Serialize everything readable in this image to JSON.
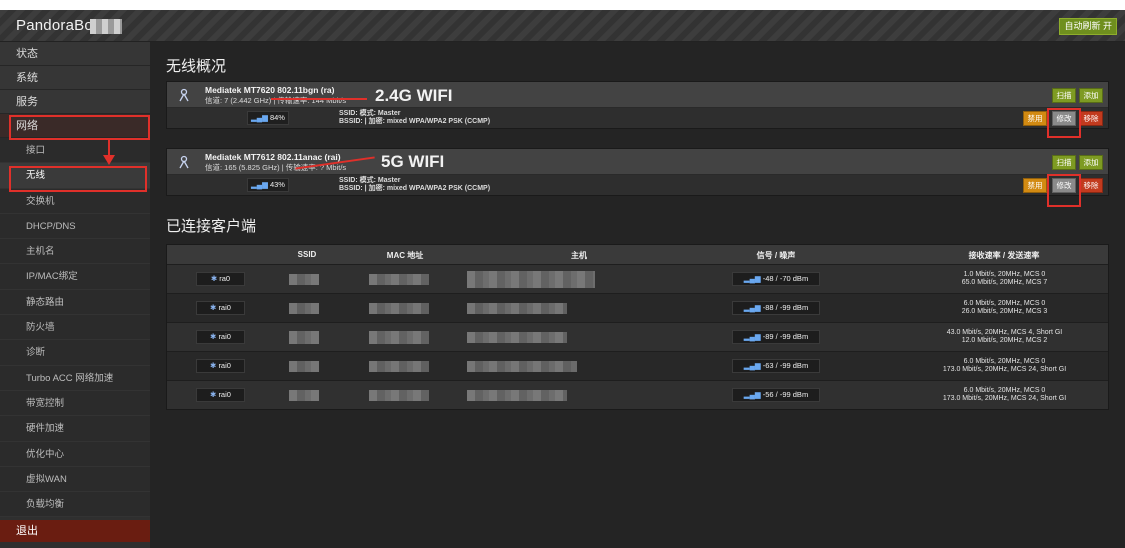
{
  "header": {
    "brand": "PandoraBox",
    "auto_refresh": "自动刷新 开"
  },
  "sidebar": {
    "top_items": [
      "状态",
      "系统",
      "服务",
      "网络"
    ],
    "sub_items": [
      "接口",
      "无线",
      "交换机",
      "DHCP/DNS",
      "主机名",
      "IP/MAC绑定",
      "静态路由",
      "防火墙",
      "诊断",
      "Turbo ACC 网络加速",
      "带宽控制",
      "硬件加速",
      "优化中心",
      "虚拟WAN",
      "负载均衡"
    ],
    "logout": "退出"
  },
  "overview": {
    "title": "无线概况",
    "radios": [
      {
        "name": "Mediatek MT7620 802.11bgn (ra)",
        "info": "信道: 7 (2.442 GHz) | 传输速率: 144 Mbit/s",
        "callout": "2.4G WIFI",
        "signal": "84%",
        "ssid_line": "SSID:          模式: Master",
        "bssid_line": "BSSID:                        | 加密: mixed WPA/WPA2 PSK (CCMP)",
        "btn_scan": "扫描",
        "btn_add": "添加",
        "btn_disable": "禁用",
        "btn_edit": "修改",
        "btn_remove": "移除"
      },
      {
        "name": "Mediatek MT7612 802.11anac (rai)",
        "info": "信道: 165 (5.825 GHz) | 传输速率: ? Mbit/s",
        "callout": "5G WIFI",
        "signal": "43%",
        "ssid_line": "SSID:          模式: Master",
        "bssid_line": "BSSID:                        | 加密: mixed WPA/WPA2 PSK (CCMP)",
        "btn_scan": "扫描",
        "btn_add": "添加",
        "btn_disable": "禁用",
        "btn_edit": "修改",
        "btn_remove": "移除"
      }
    ]
  },
  "clients": {
    "title": "已连接客户端",
    "columns": [
      "SSID",
      "MAC 地址",
      "主机",
      "信号 / 噪声",
      "接收速率 / 发送速率"
    ],
    "rows": [
      {
        "iface": "ra0",
        "signal": "-48 / -70 dBm",
        "rate1": "1.0 Mbit/s, 20MHz, MCS 0",
        "rate2": "65.0 Mbit/s, 20MHz, MCS 7"
      },
      {
        "iface": "rai0",
        "signal": "-88 / -99 dBm",
        "rate1": "6.0 Mbit/s, 20MHz, MCS 0",
        "rate2": "26.0 Mbit/s, 20MHz, MCS 3"
      },
      {
        "iface": "rai0",
        "signal": "-89 / -99 dBm",
        "rate1": "43.0 Mbit/s, 20MHz, MCS 4, Short GI",
        "rate2": "12.0 Mbit/s, 20MHz, MCS 2"
      },
      {
        "iface": "rai0",
        "signal": "-63 / -99 dBm",
        "rate1": "6.0 Mbit/s, 20MHz, MCS 0",
        "rate2": "173.0 Mbit/s, 20MHz, MCS 24, Short GI"
      },
      {
        "iface": "rai0",
        "signal": "-56 / -99 dBm",
        "rate1": "6.0 Mbit/s, 20MHz, MCS 0",
        "rate2": "173.0 Mbit/s, 20MHz, MCS 24, Short GI"
      }
    ]
  },
  "colors": {
    "annotation_red": "#e0302a",
    "button_green": "#7e9b22",
    "button_orange": "#d28a12",
    "button_red": "#c23a1e",
    "logout_bg": "#6a1d11"
  }
}
